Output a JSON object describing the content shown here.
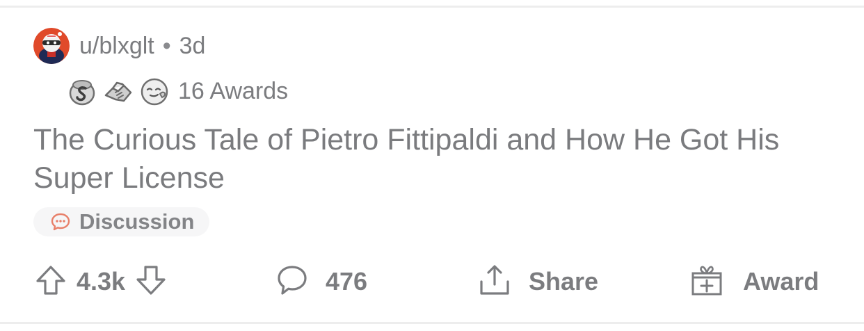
{
  "post": {
    "author": "u/blxglt",
    "separator": "•",
    "age": "3d",
    "awards": {
      "icons": [
        "silver-award-icon",
        "helping-hand-award-icon",
        "wholesome-award-icon"
      ],
      "count_label": "16 Awards"
    },
    "title": "The Curious Tale of Pietro Fittipaldi and How He Got His Super License",
    "flair": {
      "icon": "speech-bubble-icon",
      "label": "Discussion",
      "icon_color": "#e8806a"
    }
  },
  "actions": {
    "upvotes": "4.3k",
    "comments": "476",
    "share_label": "Share",
    "award_label": "Award"
  },
  "colors": {
    "text_gray": "#7b7c7f",
    "avatar_red": "#e04a2a",
    "flair_bg": "#f6f6f7"
  }
}
